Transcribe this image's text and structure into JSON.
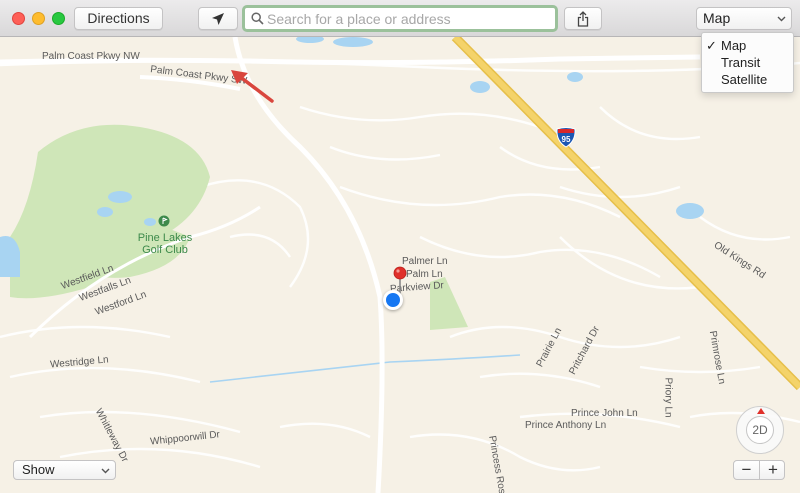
{
  "toolbar": {
    "directions_label": "Directions",
    "search_placeholder": "Search for a place or address",
    "map_type_selected": "Map"
  },
  "map_type_menu": {
    "items": [
      {
        "label": "Map",
        "checked": true
      },
      {
        "label": "Transit",
        "checked": false
      },
      {
        "label": "Satellite",
        "checked": false
      }
    ]
  },
  "map": {
    "roads": {
      "palm_coast_nw": "Palm Coast Pkwy NW",
      "palm_coast_sw": "Palm Coast Pkwy SW",
      "old_kings": "Old Kings Rd",
      "westfield": "Westfield Ln",
      "westfalls": "Westfalls Ln",
      "westford": "Westford Ln",
      "westridge": "Westridge Ln",
      "whitleway": "Whitleway Dr",
      "whippoorwill": "Whippoorwill Dr",
      "palmer": "Palmer Ln",
      "palm": "Palm Ln",
      "parkview": "Parkview Dr",
      "prairie": "Prairie Ln",
      "pritchard": "Pritchard Dr",
      "primrose": "Primrose Ln",
      "priory": "Priory Ln",
      "prince_john": "Prince John Ln",
      "prince_anthony": "Prince Anthony Ln",
      "princess_rose": "Princess Rose"
    },
    "poi": {
      "golf_line1": "Pine Lakes",
      "golf_line2": "Golf Club"
    },
    "highway_shield": "95",
    "compass_mode": "2D"
  },
  "bottom": {
    "show_label": "Show"
  },
  "colors": {
    "land": "#f6f1e6",
    "park": "#cfe6b8",
    "water": "#a8d4f2",
    "highway": "#f4d36a",
    "accent_blue": "#1677f2",
    "pin_red": "#e0302a",
    "search_focus": "#9bc19b"
  }
}
